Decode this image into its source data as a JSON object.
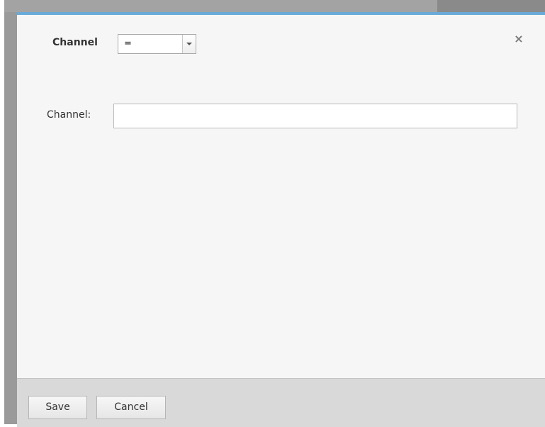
{
  "dialog": {
    "filter_label": "Channel",
    "operator_select": {
      "value": "="
    },
    "close_icon": "close-icon",
    "field_label": "Channel:",
    "field_value": "",
    "save_label": "Save",
    "cancel_label": "Cancel"
  },
  "colors": {
    "accent": "#6aaad8",
    "dialog_bg": "#f6f6f6",
    "footer_bg": "#d9d9d9"
  }
}
